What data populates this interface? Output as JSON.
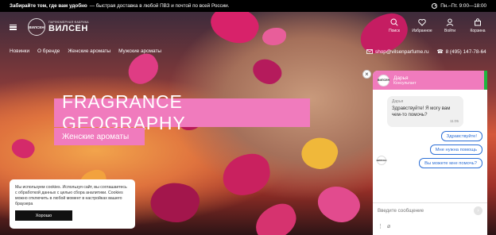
{
  "topbar": {
    "lead": "Забирайте том, где вам удобно",
    "text": "— быстрая доставка в любой ПВЗ и почтой по всей России.",
    "hours": "Пн.–Пт. 9:00—18:00",
    "clock_icon": "clock-icon"
  },
  "logo": {
    "emblem": "ВИЛСЕН",
    "subtitle": "ПАРФЮМЕРНАЯ ФАБРИКА",
    "name": "ВИЛСЕН"
  },
  "header_icons": [
    {
      "icon": "search-icon",
      "label": "Поиск"
    },
    {
      "icon": "heart-icon",
      "label": "Избранное"
    },
    {
      "icon": "user-icon",
      "label": "Войти"
    },
    {
      "icon": "cart-icon",
      "label": "Корзина"
    }
  ],
  "nav": {
    "items": [
      "Новинки",
      "О бренде",
      "Женские ароматы",
      "Мужские ароматы"
    ],
    "email": "shop@vilsenparfume.ru",
    "phone": "8 (495) 147-78-64"
  },
  "hero": {
    "title": "FRAGRANCE GEOGRAPHY",
    "subtitle": "Женские ароматы",
    "accent_color": "#f07bbd"
  },
  "cookie": {
    "text": "Мы используем cookies. Используя сайт, вы соглашаетесь с обработкой данных с целью сбора аналитики. Cookies можно отключить в любой момент в настройках вашего браузера",
    "button": "Хорошо"
  },
  "chat": {
    "agent_name": "Дарья",
    "agent_role": "Консультант",
    "avatar_text": "ВИЛСЕН",
    "message_author": "Дарья",
    "message_text": "Здравствуйте! Я могу вам чем-то помочь?",
    "message_time": "11:05",
    "quick_replies": [
      "Здравствуйте!",
      "Мне нужна помощь",
      "Вы можете мне помочь?"
    ],
    "input_placeholder": "Введите сообщение",
    "close_label": "×",
    "send_icon": "send-icon",
    "status_color": "#1fb63f"
  }
}
